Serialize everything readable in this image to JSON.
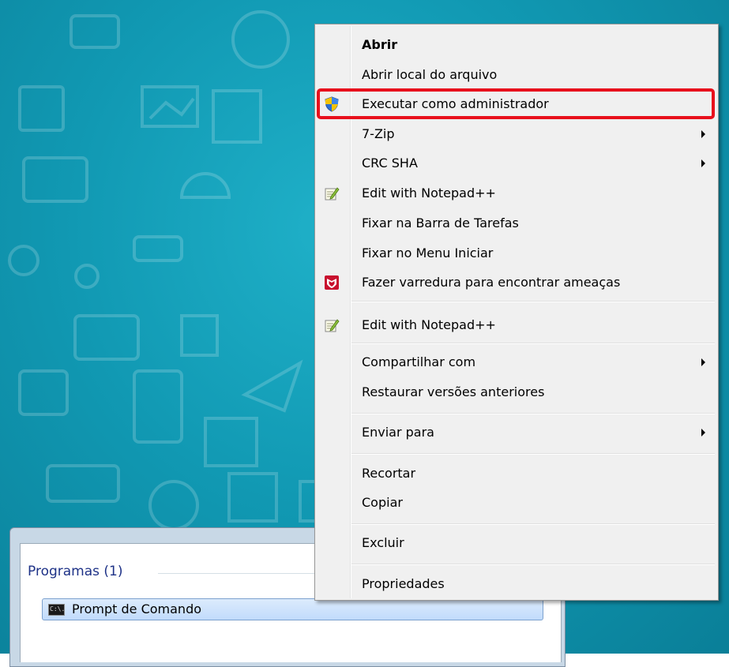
{
  "context_menu": {
    "items": [
      {
        "label": "Abrir",
        "bold": true,
        "icon": null,
        "submenu": false
      },
      {
        "label": "Abrir local do arquivo",
        "bold": false,
        "icon": null,
        "submenu": false
      },
      {
        "label": "Executar como administrador",
        "bold": false,
        "icon": "uac-shield-icon",
        "submenu": false,
        "highlighted": true
      },
      {
        "label": "7-Zip",
        "bold": false,
        "icon": null,
        "submenu": true
      },
      {
        "label": "CRC SHA",
        "bold": false,
        "icon": null,
        "submenu": true
      },
      {
        "label": "Edit with Notepad++",
        "bold": false,
        "icon": "notepad-plus-plus-icon",
        "submenu": false
      },
      {
        "label": "Fixar na Barra de Tarefas",
        "bold": false,
        "icon": null,
        "submenu": false
      },
      {
        "label": "Fixar no Menu Iniciar",
        "bold": false,
        "icon": null,
        "submenu": false
      },
      {
        "label": "Fazer varredura para encontrar ameaças",
        "bold": false,
        "icon": "mcafee-icon",
        "submenu": false
      },
      {
        "label": "Edit with Notepad++",
        "bold": false,
        "icon": "notepad-plus-plus-icon",
        "submenu": false
      },
      {
        "label": "Compartilhar com",
        "bold": false,
        "icon": null,
        "submenu": true
      },
      {
        "label": "Restaurar versões anteriores",
        "bold": false,
        "icon": null,
        "submenu": false
      },
      {
        "label": "Enviar para",
        "bold": false,
        "icon": null,
        "submenu": true
      },
      {
        "label": "Recortar",
        "bold": false,
        "icon": null,
        "submenu": false
      },
      {
        "label": "Copiar",
        "bold": false,
        "icon": null,
        "submenu": false
      },
      {
        "label": "Excluir",
        "bold": false,
        "icon": null,
        "submenu": false
      },
      {
        "label": "Propriedades",
        "bold": false,
        "icon": null,
        "submenu": false
      }
    ],
    "highlight_color": "#e8101c"
  },
  "start_menu": {
    "group_header": "Programas (1)",
    "results": [
      {
        "label": "Prompt de Comando",
        "icon": "command-prompt-icon",
        "icon_text": "C:\\."
      }
    ]
  },
  "colors": {
    "desktop": "#1199b3",
    "menu_background": "#f0f0f0",
    "selection": "#c1dbfc"
  }
}
